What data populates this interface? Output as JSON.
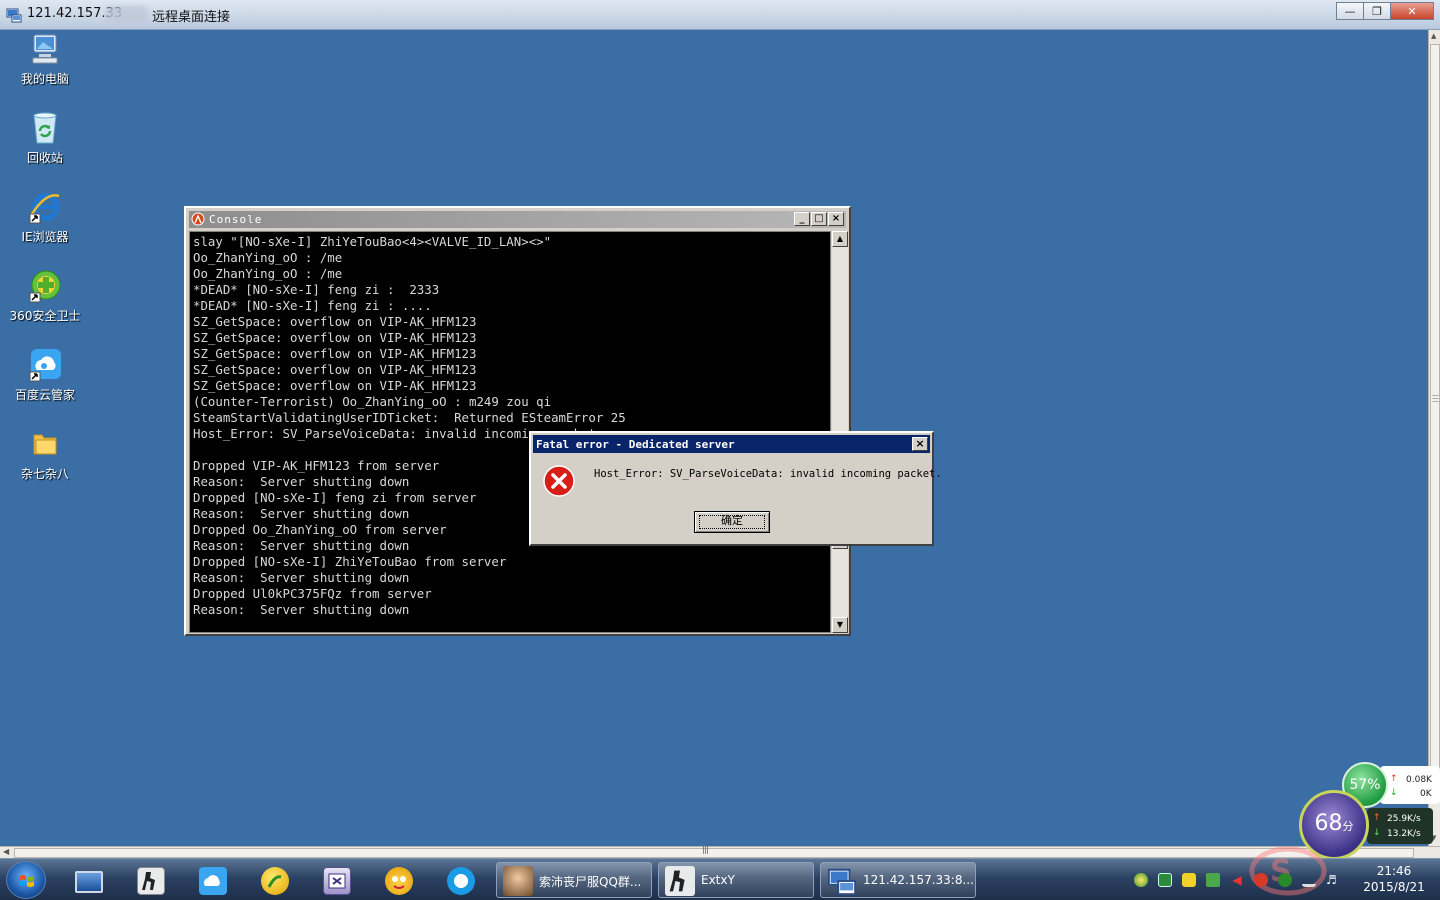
{
  "rdp_window": {
    "title_host": "121.42.157.33",
    "title_suffix": "远程桌面连接",
    "icon": "remote-desktop-icon",
    "buttons": [
      "minimize",
      "restore",
      "close"
    ]
  },
  "desktop": {
    "background_color": "#3a6ea5",
    "icons": [
      {
        "label": "我的电脑",
        "icon": "computer-icon"
      },
      {
        "label": "回收站",
        "icon": "recycle-bin-icon"
      },
      {
        "label": "IE浏览器",
        "icon": "ie-browser-icon"
      },
      {
        "label": "360安全卫士",
        "icon": "360-security-icon"
      },
      {
        "label": "百度云管家",
        "icon": "baidu-cloud-icon"
      },
      {
        "label": "杂七杂八",
        "icon": "folder-icon"
      }
    ]
  },
  "console": {
    "title": "Console",
    "lines": [
      "slay \"[NO-sXe-I] ZhiYeTouBao<4><VALVE_ID_LAN><>\"",
      "Oo_ZhanYing_oO : /me",
      "Oo_ZhanYing_oO : /me",
      "*DEAD* [NO-sXe-I] feng zi :  2333",
      "*DEAD* [NO-sXe-I] feng zi : ....",
      "SZ_GetSpace: overflow on VIP-AK_HFM123",
      "SZ_GetSpace: overflow on VIP-AK_HFM123",
      "SZ_GetSpace: overflow on VIP-AK_HFM123",
      "SZ_GetSpace: overflow on VIP-AK_HFM123",
      "SZ_GetSpace: overflow on VIP-AK_HFM123",
      "(Counter-Terrorist) Oo_ZhanYing_oO : m249 zou qi",
      "SteamStartValidatingUserIDTicket:  Returned ESteamError 25",
      "Host_Error: SV_ParseVoiceData: invalid incoming packet",
      "",
      "Dropped VIP-AK_HFM123 from server",
      "Reason:  Server shutting down",
      "Dropped [NO-sXe-I] feng zi from server",
      "Reason:  Server shutting down",
      "Dropped Oo_ZhanYing_oO from server",
      "Reason:  Server shutting down",
      "Dropped [NO-sXe-I] ZhiYeTouBao from server",
      "Reason:  Server shutting down",
      "Dropped Ul0kPC375FQz from server",
      "Reason:  Server shutting down"
    ]
  },
  "dialog": {
    "title": "Fatal error - Dedicated server",
    "message": "Host_Error: SV_ParseVoiceData: invalid incoming packet.",
    "ok_label": "确定",
    "icon": "error-icon"
  },
  "speed_widget": {
    "memory_percent": "57%",
    "score": "68",
    "score_unit": "分",
    "upload_top": "0.08K",
    "download_top": "0K",
    "upload_speed": "25.9K/s",
    "download_speed": "13.2K/s"
  },
  "taskbar": {
    "pinned": [
      {
        "icon": "show-desktop-icon"
      },
      {
        "icon": "counter-strike-icon"
      },
      {
        "icon": "baidu-cloud-icon"
      },
      {
        "icon": "music-player-icon"
      },
      {
        "icon": "tool-icon"
      },
      {
        "icon": "ftp-icon"
      },
      {
        "icon": "qq-browser-icon"
      }
    ],
    "tasks": [
      {
        "label": "索沛丧尸服QQ群...",
        "icon": "qq-group-avatar-icon"
      },
      {
        "label": "ExtxY",
        "icon": "counter-strike-icon"
      },
      {
        "label": "121.42.157.33:8...",
        "icon": "remote-desktop-icon"
      }
    ],
    "clock_time": "21:46",
    "clock_date": "2015/8/21"
  }
}
